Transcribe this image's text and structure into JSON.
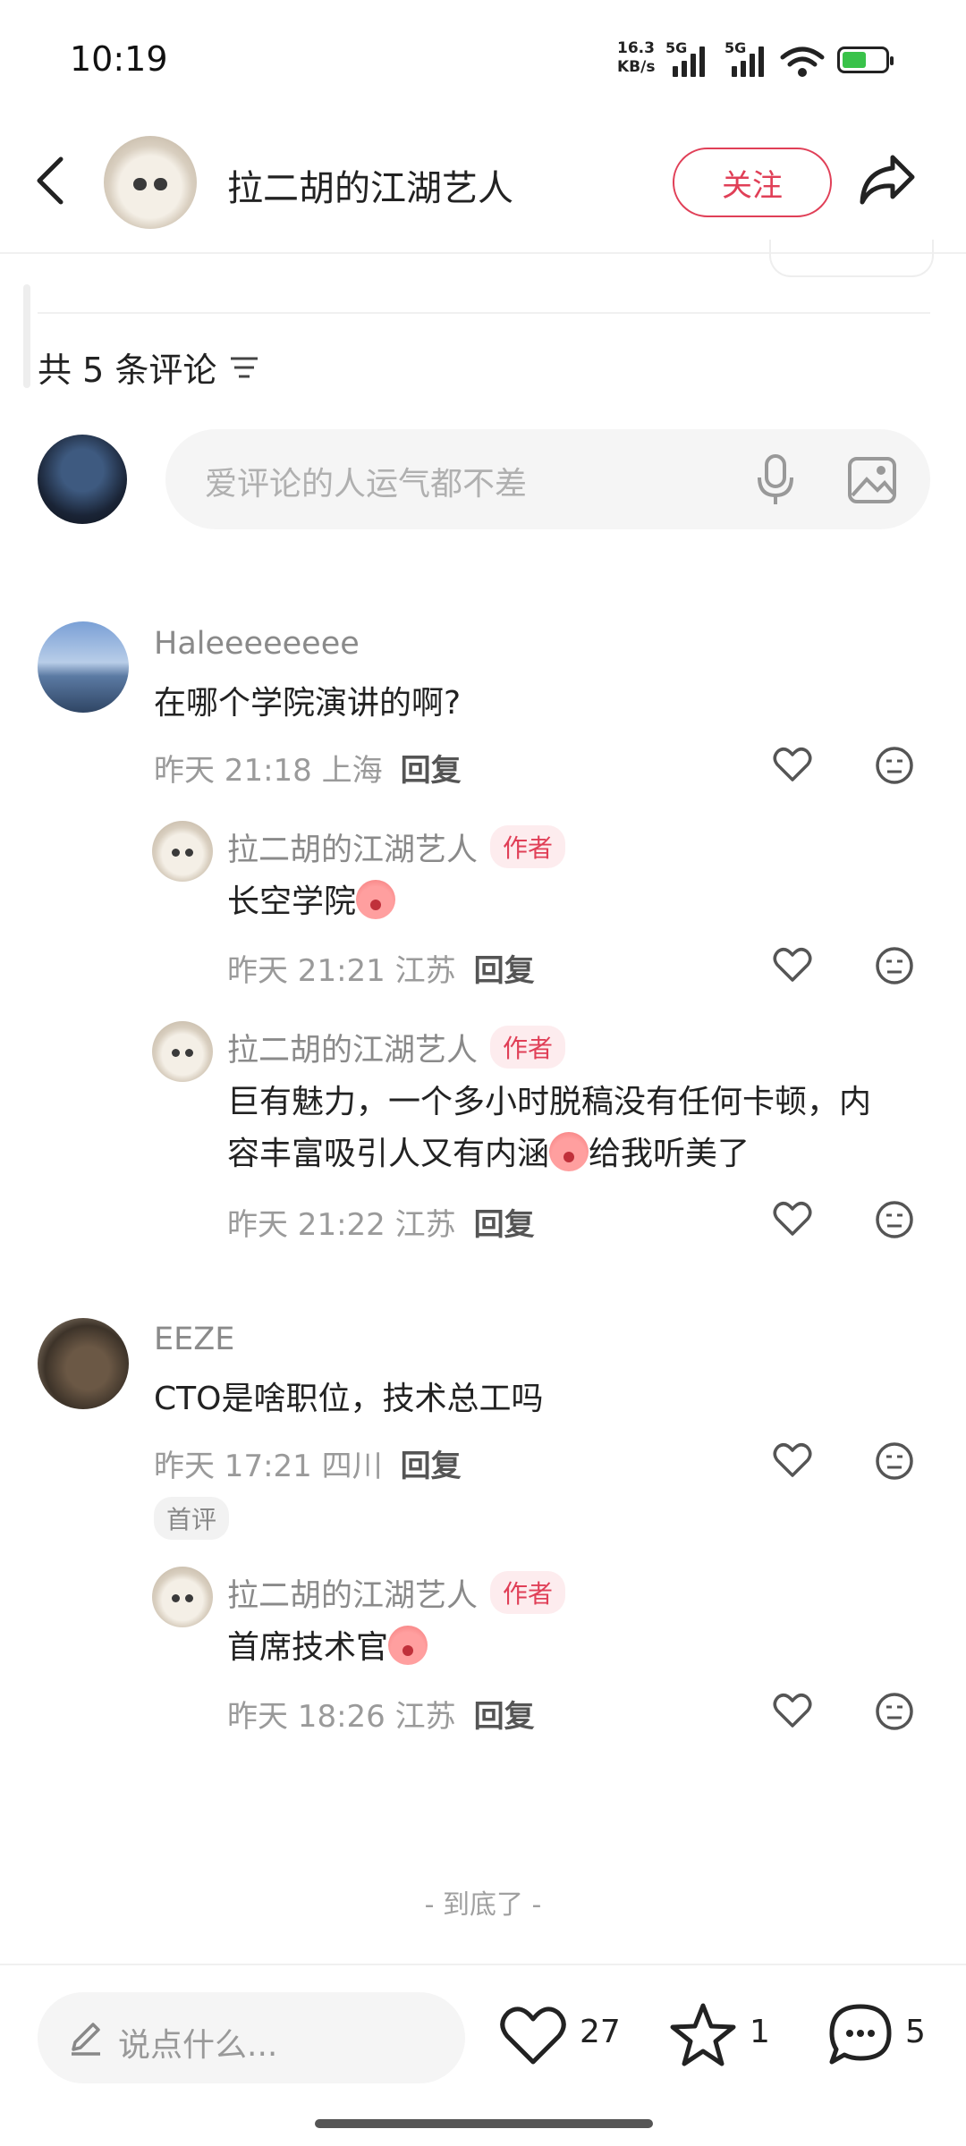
{
  "status_bar": {
    "time": "10:19",
    "net_speed_top": "16.3",
    "net_speed_bottom": "KB/s",
    "sim1": "5G",
    "sim2": "5G"
  },
  "header": {
    "title": "拉二胡的江湖艺人",
    "follow_label": "关注"
  },
  "comments_header": {
    "count_label": "共 5 条评论"
  },
  "comment_input": {
    "placeholder": "爱评论的人运气都不差"
  },
  "comments": [
    {
      "username": "Haleeeeeeee",
      "text": "在哪个学院演讲的啊?",
      "meta": "昨天 21:18 上海",
      "reply_label": "回复",
      "replies": [
        {
          "username": "拉二胡的江湖艺人",
          "badge": "作者",
          "text": "长空学院",
          "meta": "昨天 21:21 江苏",
          "reply_label": "回复"
        },
        {
          "username": "拉二胡的江湖艺人",
          "badge": "作者",
          "text_line1": "巨有魅力，一个多小时脱稿没有任何卡顿，内",
          "text_line2a": "容丰富吸引人又有内涵",
          "text_line2b": "给我听美了",
          "meta": "昨天 21:22 江苏",
          "reply_label": "回复"
        }
      ]
    },
    {
      "username": "EEZE",
      "text": "CTO是啥职位，技术总工吗",
      "meta": "昨天 17:21 四川",
      "reply_label": "回复",
      "first_badge": "首评",
      "replies": [
        {
          "username": "拉二胡的江湖艺人",
          "badge": "作者",
          "text": "首席技术官",
          "meta": "昨天 18:26 江苏",
          "reply_label": "回复"
        }
      ]
    }
  ],
  "end_text": "- 到底了 -",
  "bottom_bar": {
    "input_placeholder": "说点什么...",
    "likes": "27",
    "stars": "1",
    "comments": "5"
  }
}
